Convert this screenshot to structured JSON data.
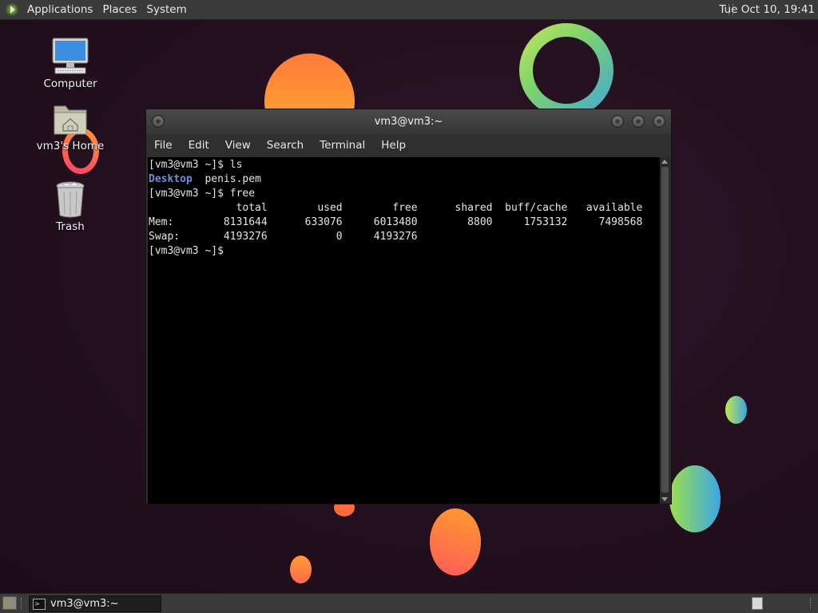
{
  "top_panel": {
    "menus": [
      "Applications",
      "Places",
      "System"
    ],
    "clock": "Tue Oct 10, 19:41"
  },
  "desktop_icons": {
    "computer": "Computer",
    "home": "vm3's Home",
    "trash": "Trash"
  },
  "terminal_window": {
    "title": "vm3@vm3:~",
    "menus": [
      "File",
      "Edit",
      "View",
      "Search",
      "Terminal",
      "Help"
    ],
    "lines": {
      "l1": "[vm3@vm3 ~]$ ls",
      "l2_dir": "Desktop",
      "l2_file": "  penis.pem",
      "l3": "[vm3@vm3 ~]$ free",
      "l4": "              total        used        free      shared  buff/cache   available",
      "l5": "Mem:        8131644      633076     6013480        8800     1753132     7498568",
      "l6": "Swap:       4193276           0     4193276",
      "l7": "[vm3@vm3 ~]$ "
    }
  },
  "bottom_panel": {
    "task": "vm3@vm3:~"
  },
  "colors": {
    "accent_directory": "#6f8fd8",
    "panel": "#3a3a3a",
    "terminal_bg": "#000000"
  },
  "icons": [
    "mate-logo-icon",
    "computer-icon",
    "home-folder-icon",
    "trash-icon",
    "terminal-icon",
    "show-desktop-icon"
  ]
}
